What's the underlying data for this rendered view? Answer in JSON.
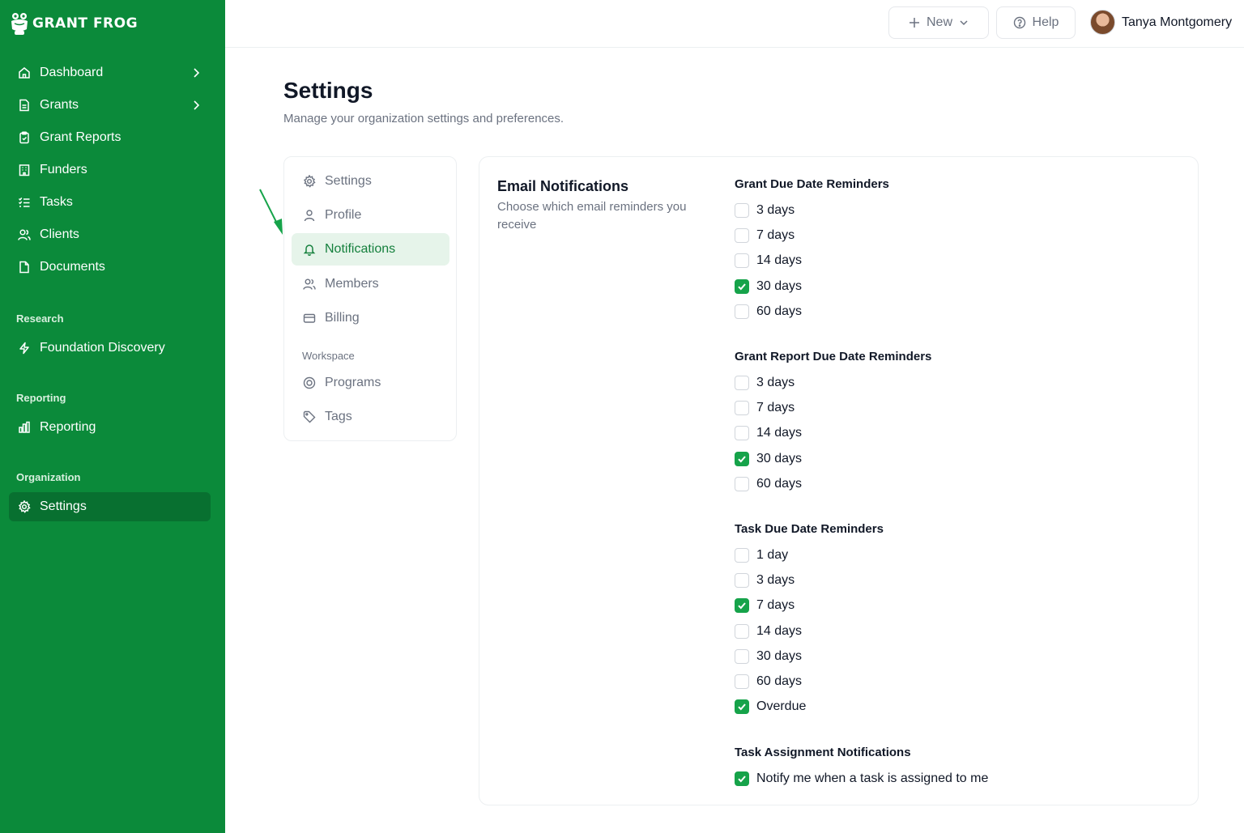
{
  "brand": {
    "name": "GRANT FROG",
    "color": "#0b8a3a",
    "accent": "#16a34a"
  },
  "sidebar": {
    "items": [
      {
        "label": "Dashboard",
        "icon": "home-icon",
        "chevron": true
      },
      {
        "label": "Grants",
        "icon": "file-icon",
        "chevron": true
      },
      {
        "label": "Grant Reports",
        "icon": "clipboard-icon",
        "chevron": false
      },
      {
        "label": "Funders",
        "icon": "building-icon",
        "chevron": false
      },
      {
        "label": "Tasks",
        "icon": "list-checks-icon",
        "chevron": false
      },
      {
        "label": "Clients",
        "icon": "users-icon",
        "chevron": false
      },
      {
        "label": "Documents",
        "icon": "document-icon",
        "chevron": false
      }
    ],
    "research_label": "Research",
    "research_items": [
      {
        "label": "Foundation Discovery",
        "icon": "bolt-icon"
      }
    ],
    "reporting_label": "Reporting",
    "reporting_items": [
      {
        "label": "Reporting",
        "icon": "bar-chart-icon"
      }
    ],
    "organization_label": "Organization",
    "organization_items": [
      {
        "label": "Settings",
        "icon": "gear-icon",
        "active": true
      }
    ]
  },
  "topbar": {
    "new_label": "New",
    "help_label": "Help",
    "user_name": "Tanya Montgomery"
  },
  "page": {
    "title": "Settings",
    "subtitle": "Manage your organization settings and preferences."
  },
  "settings_menu": {
    "items": [
      {
        "label": "Settings",
        "icon": "gear-icon"
      },
      {
        "label": "Profile",
        "icon": "user-icon"
      },
      {
        "label": "Notifications",
        "icon": "bell-icon",
        "active": true
      },
      {
        "label": "Members",
        "icon": "users-icon"
      },
      {
        "label": "Billing",
        "icon": "credit-card-icon"
      }
    ],
    "workspace_label": "Workspace",
    "workspace_items": [
      {
        "label": "Programs",
        "icon": "target-icon"
      },
      {
        "label": "Tags",
        "icon": "tag-icon"
      }
    ]
  },
  "notifications": {
    "title": "Email Notifications",
    "description": "Choose which email reminders you receive",
    "groups": [
      {
        "title": "Grant Due Date Reminders",
        "options": [
          {
            "label": "3 days",
            "checked": false
          },
          {
            "label": "7 days",
            "checked": false
          },
          {
            "label": "14 days",
            "checked": false
          },
          {
            "label": "30 days",
            "checked": true
          },
          {
            "label": "60 days",
            "checked": false
          }
        ]
      },
      {
        "title": "Grant Report Due Date Reminders",
        "options": [
          {
            "label": "3 days",
            "checked": false
          },
          {
            "label": "7 days",
            "checked": false
          },
          {
            "label": "14 days",
            "checked": false
          },
          {
            "label": "30 days",
            "checked": true
          },
          {
            "label": "60 days",
            "checked": false
          }
        ]
      },
      {
        "title": "Task Due Date Reminders",
        "options": [
          {
            "label": "1 day",
            "checked": false
          },
          {
            "label": "3 days",
            "checked": false
          },
          {
            "label": "7 days",
            "checked": true
          },
          {
            "label": "14 days",
            "checked": false
          },
          {
            "label": "30 days",
            "checked": false
          },
          {
            "label": "60 days",
            "checked": false
          },
          {
            "label": "Overdue",
            "checked": true
          }
        ]
      },
      {
        "title": "Task Assignment Notifications",
        "options": [
          {
            "label": "Notify me when a task is assigned to me",
            "checked": true
          }
        ]
      }
    ]
  }
}
